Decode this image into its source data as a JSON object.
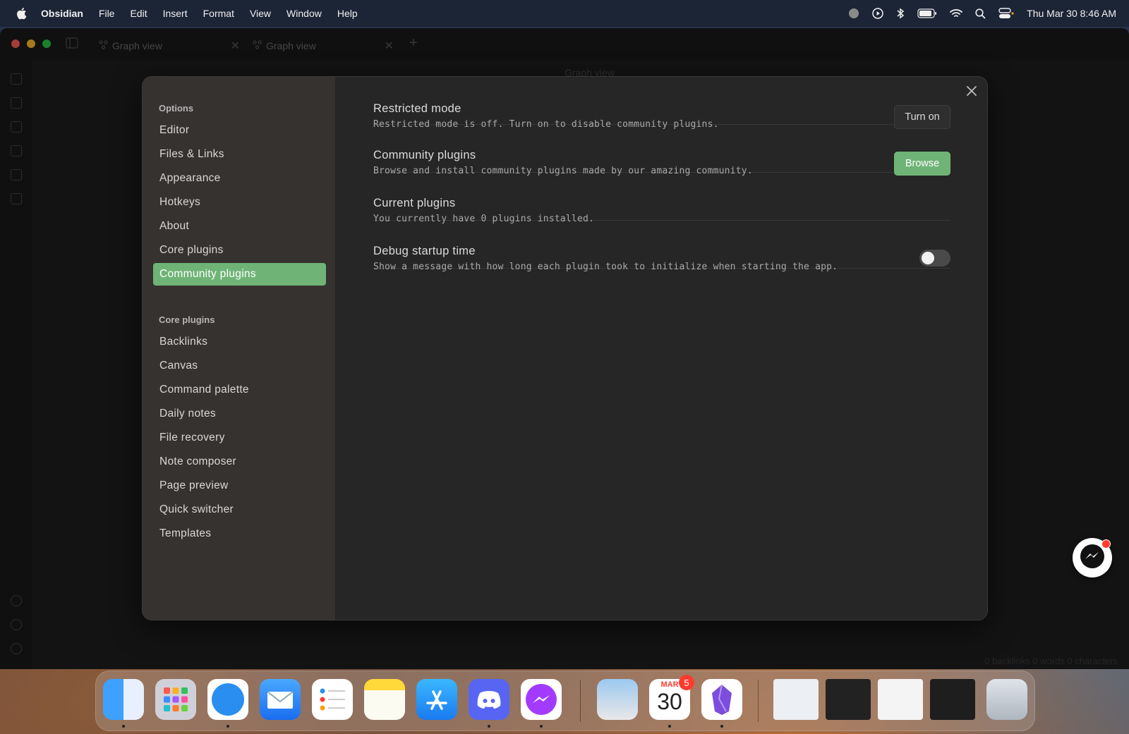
{
  "menubar": {
    "app_name": "Obsidian",
    "items": [
      "File",
      "Edit",
      "Insert",
      "Format",
      "View",
      "Window",
      "Help"
    ],
    "clock": "Thu Mar 30  8:46 AM"
  },
  "window": {
    "tabs": [
      "Graph view",
      "Graph view"
    ],
    "title": "Graph view",
    "status": "0 backlinks   0 words   0 characters"
  },
  "settings": {
    "sidebar": {
      "options_title": "Options",
      "options": [
        "Editor",
        "Files & Links",
        "Appearance",
        "Hotkeys",
        "About",
        "Core plugins",
        "Community plugins"
      ],
      "active": "Community plugins",
      "core_title": "Core plugins",
      "core": [
        "Backlinks",
        "Canvas",
        "Command palette",
        "Daily notes",
        "File recovery",
        "Note composer",
        "Page preview",
        "Quick switcher",
        "Templates"
      ]
    },
    "items": [
      {
        "name": "Restricted mode",
        "desc": "Restricted mode is off. Turn on to disable community plugins.",
        "button": "Turn on"
      },
      {
        "name": "Community plugins",
        "desc": "Browse and install community plugins made by our amazing community.",
        "button": "Browse"
      },
      {
        "name": "Current plugins",
        "desc": "You currently have 0 plugins installed."
      },
      {
        "name": "Debug startup time",
        "desc": "Show a message with how long each plugin took to initialize when starting the app.",
        "toggle": false
      }
    ]
  },
  "dock": {
    "calendar_month": "MAR",
    "calendar_day": "30",
    "calendar_badge": "5"
  },
  "colors": {
    "accent": "#6fb476",
    "sidebar_bg": "#363230",
    "content_bg": "#262626"
  }
}
